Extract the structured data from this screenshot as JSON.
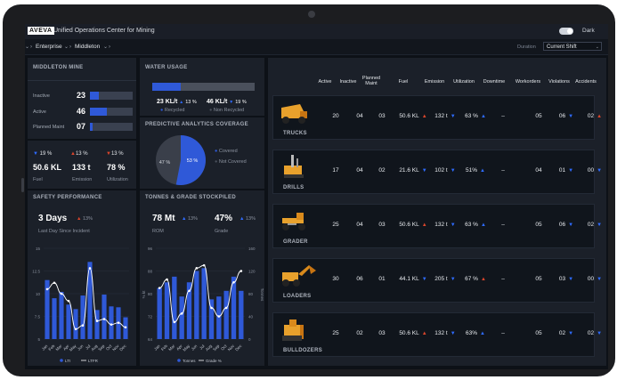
{
  "app": {
    "logo": "AVEVA",
    "title": "Unified Operations Center for Mining",
    "dark_label": "Dark"
  },
  "breadcrumb": {
    "enterprise": "Enterprise",
    "site": "Middleton"
  },
  "duration": {
    "label": "Duration",
    "value": "Current Shift"
  },
  "mine": {
    "title": "MIDDLETON MINE",
    "rows": [
      {
        "label": "Inactive",
        "value": "23",
        "fill": 0.2
      },
      {
        "label": "Active",
        "value": "46",
        "fill": 0.4
      },
      {
        "label": "Planned Maint",
        "value": "07",
        "fill": 0.07
      }
    ],
    "kpis": [
      {
        "delta": "19 %",
        "dir": "down",
        "value": "50.6 KL",
        "label": "Fuel"
      },
      {
        "delta": "13 %",
        "dir": "up",
        "value": "133 t",
        "label": "Emission"
      },
      {
        "delta": "13 %",
        "dir": "up",
        "value": "78 %",
        "label": "Utilization"
      }
    ]
  },
  "water": {
    "title": "WATER USAGE",
    "recycled_fill": 0.28,
    "recycled_value": "23 KL/t",
    "recycled_delta": "13 %",
    "recycled_label": "Recycled",
    "nonrecycled_value": "46 KL/t",
    "nonrecycled_delta": "19 %",
    "nonrecycled_label": "Non Recycled"
  },
  "pa": {
    "title": "PREDICTIVE ANALYTICS COVERAGE",
    "covered_pct": 53,
    "covered_text": "53 %",
    "notcovered_text": "47 %",
    "covered_label": "Covered",
    "notcovered_label": "Not Covered"
  },
  "safety": {
    "title": "SAFETY PERFORMANCE",
    "days": "3 Days",
    "delta": "13%",
    "sub": "Last Day Since Incident",
    "legend_ltt": "LTI",
    "legend_ltfr": "LTIFR"
  },
  "tonnes": {
    "title": "TONNES & GRADE STOCKPILED",
    "rom": "78 Mt",
    "rom_delta": "13%",
    "rom_label": "ROM",
    "grade": "47%",
    "grade_delta": "13%",
    "grade_label": "Grade",
    "legend_tonnes": "Tonnes",
    "legend_grade": "Grade %",
    "ylabel_left": "% kt",
    "ylabel_right": "Tonnes"
  },
  "chart_data": [
    {
      "type": "bar",
      "title": "SAFETY PERFORMANCE",
      "categories": [
        "Jan",
        "Feb",
        "Mar",
        "Apr",
        "May",
        "Jun",
        "Jul",
        "Aug",
        "Sep",
        "Oct",
        "Nov",
        "Dec"
      ],
      "ylim": [
        5,
        15
      ],
      "yticks": [
        "5",
        "7.5",
        "10",
        "12.5",
        "15"
      ],
      "series": [
        {
          "name": "LTI",
          "type": "bar",
          "values": [
            11.5,
            9.5,
            10.2,
            8.8,
            8.3,
            9.8,
            13.5,
            8.2,
            9.9,
            8.6,
            8.5,
            7.4
          ]
        },
        {
          "name": "LTFR",
          "type": "line",
          "values": [
            10.5,
            11.2,
            10.0,
            9.2,
            6.1,
            6.5,
            12.8,
            7.0,
            7.2,
            6.6,
            6.8,
            6.3
          ]
        }
      ]
    },
    {
      "type": "bar",
      "title": "TONNES & GRADE STOCKPILED",
      "categories": [
        "Jan",
        "Feb",
        "Mar",
        "Apr",
        "May",
        "Jun",
        "Jul",
        "Aug",
        "Sep",
        "Oct",
        "Nov",
        "Dec"
      ],
      "ylim_left": [
        64,
        96
      ],
      "yticks_left": [
        "64",
        "72",
        "80",
        "88",
        "96"
      ],
      "ylim_right": [
        0,
        160
      ],
      "yticks_right": [
        "0",
        "40",
        "80",
        "120",
        "160"
      ],
      "series": [
        {
          "name": "Tonnes",
          "type": "bar",
          "values": [
            82,
            84,
            86,
            79,
            84,
            88,
            89,
            78,
            79,
            81,
            86,
            81
          ]
        },
        {
          "name": "Grade %",
          "type": "line",
          "values": [
            82,
            85,
            70,
            73,
            81,
            89,
            90,
            75,
            72,
            75,
            84,
            88
          ]
        }
      ]
    }
  ],
  "table": {
    "headers": [
      "Active",
      "Inactive",
      "Planned Maint",
      "Fuel",
      "Emission",
      "Utilization",
      "Downtime",
      "Workorders",
      "Violations",
      "Accidents"
    ],
    "rows": [
      {
        "name": "TRUCKS",
        "active": "20",
        "inactive": "04",
        "planned": "03",
        "fuel": "50.6 KL",
        "fuel_dir": "up",
        "emission": "132 t",
        "emission_dir": "down",
        "util": "63 %",
        "util_dir": "upb",
        "downtime": "–",
        "workorders": "05",
        "violations": "06",
        "violations_dir": "down",
        "accidents": "02",
        "accidents_dir": "up"
      },
      {
        "name": "DRILLS",
        "active": "17",
        "inactive": "04",
        "planned": "02",
        "fuel": "21.6 KL",
        "fuel_dir": "down",
        "emission": "102 t",
        "emission_dir": "down",
        "util": "51%",
        "util_dir": "upb",
        "downtime": "–",
        "workorders": "04",
        "violations": "01",
        "violations_dir": "down",
        "accidents": "00",
        "accidents_dir": "down"
      },
      {
        "name": "GRADER",
        "active": "25",
        "inactive": "04",
        "planned": "03",
        "fuel": "50.6 KL",
        "fuel_dir": "up",
        "emission": "132 t",
        "emission_dir": "down",
        "util": "63 %",
        "util_dir": "upb",
        "downtime": "–",
        "workorders": "05",
        "violations": "06",
        "violations_dir": "down",
        "accidents": "02",
        "accidents_dir": "down"
      },
      {
        "name": "LOADERS",
        "active": "30",
        "inactive": "06",
        "planned": "01",
        "fuel": "44.1 KL",
        "fuel_dir": "down",
        "emission": "205 t",
        "emission_dir": "down",
        "util": "67 %",
        "util_dir": "up",
        "downtime": "–",
        "workorders": "05",
        "violations": "03",
        "violations_dir": "down",
        "accidents": "00",
        "accidents_dir": "down"
      },
      {
        "name": "BULLDOZERS",
        "active": "25",
        "inactive": "02",
        "planned": "03",
        "fuel": "50.6 KL",
        "fuel_dir": "up",
        "emission": "132 t",
        "emission_dir": "down",
        "util": "63%",
        "util_dir": "upb",
        "downtime": "–",
        "workorders": "05",
        "violations": "02",
        "violations_dir": "down",
        "accidents": "02",
        "accidents_dir": "down"
      }
    ]
  }
}
